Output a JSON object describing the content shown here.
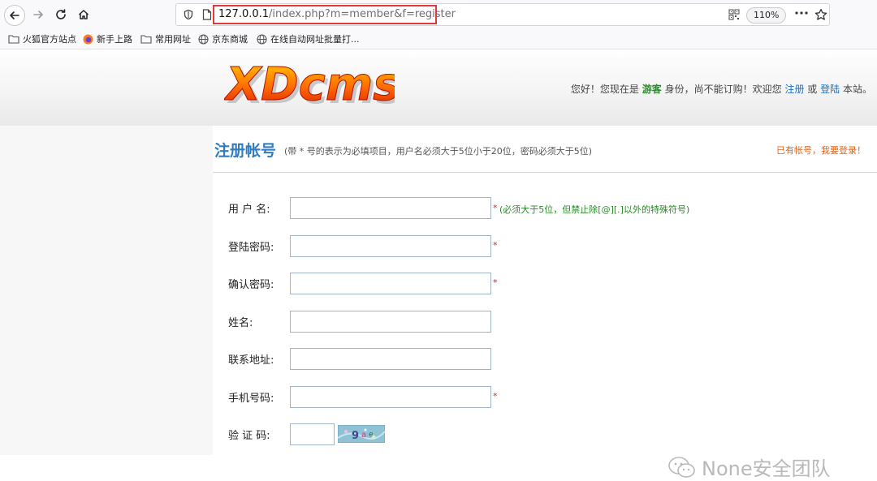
{
  "browser": {
    "url_host": "127.0.0.1",
    "url_path": "/index.php?m=member&f=register",
    "zoom": "110%"
  },
  "bookmarks": [
    {
      "label": "火狐官方站点",
      "icon": "folder-icon"
    },
    {
      "label": "新手上路",
      "icon": "firefox-icon"
    },
    {
      "label": "常用网址",
      "icon": "folder-icon"
    },
    {
      "label": "京东商城",
      "icon": "globe-icon"
    },
    {
      "label": "在线自动网址批量打...",
      "icon": "globe-icon"
    }
  ],
  "header": {
    "logo": "XDcms",
    "welcome_prefix": "您好！您现在是",
    "welcome_guest": "游客",
    "welcome_middle": "身份，尚不能订购！欢迎您",
    "register_link": "注册",
    "or_text": "或",
    "login_link": "登陆",
    "welcome_suffix": "本站。"
  },
  "register": {
    "title": "注册帐号",
    "note": "(带 * 号的表示为必填项目，用户名必须大于5位小于20位，密码必须大于5位)",
    "have_account_link": "已有帐号，我要登录！",
    "required_mark": "*",
    "username_hint": "(必须大于5位，但禁止除[@][.]以外的特殊符号)",
    "fields": [
      {
        "label": "用 户 名:",
        "value": "",
        "required": true
      },
      {
        "label": "登陆密码:",
        "value": "",
        "required": true
      },
      {
        "label": "确认密码:",
        "value": "",
        "required": true
      },
      {
        "label": "姓名:",
        "value": "",
        "required": false
      },
      {
        "label": "联系地址:",
        "value": "",
        "required": false
      },
      {
        "label": "手机号码:",
        "value": "",
        "required": true
      },
      {
        "label": "验 证 码:",
        "value": "",
        "required": false
      }
    ],
    "captcha_text": "9"
  },
  "watermark": "None安全团队",
  "colors": {
    "accent_blue": "#2f7cc0",
    "guest_green": "#2a8a2a",
    "link_orange": "#e2631c",
    "required_red": "#e02020",
    "url_highlight": "#e23a3a"
  }
}
